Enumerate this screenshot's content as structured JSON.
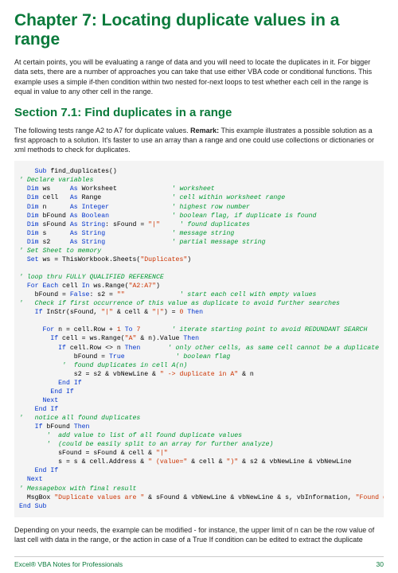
{
  "chapter_title": "Chapter 7: Locating duplicate values in a range",
  "intro_p": "At certain points, you will be evaluating a range of data and you will need to locate the duplicates in it. For bigger data sets, there are a number of approaches you can take that use either VBA code or conditional functions. This example uses a simple if-then condition within two nested for-next loops to test whether each cell in the range is equal in value to any other cell in the range.",
  "section_title": "Section 7.1: Find duplicates in a range",
  "section_p_lead": "The following tests range A2 to A7 for duplicate values. ",
  "section_p_bold": "Remark:",
  "section_p_rest": " This example illustrates a possible solution as a first approach to a solution. It's faster to use an array than a range and one could use collections or dictionaries or xml methods to check for duplicates.",
  "code": {
    "l1a": "Sub",
    "l1b": " find_duplicates()",
    "l2": "' Declare variables",
    "l3a": "Dim",
    "l3b": " ws     ",
    "l3c": "As",
    "l3d": " Worksheet              ",
    "l3e": "' worksheet",
    "l4a": "Dim",
    "l4b": " cell   ",
    "l4c": "As",
    "l4d": " Range                  ",
    "l4e": "' cell within worksheet range",
    "l5a": "Dim",
    "l5b": " n      ",
    "l5c": "As",
    "l5d": " ",
    "l5e": "Integer",
    "l5f": "                ",
    "l5g": "' highest row number",
    "l6a": "Dim",
    "l6b": " bFound ",
    "l6c": "As",
    "l6d": " ",
    "l6e": "Boolean",
    "l6f": "                ",
    "l6g": "' boolean flag, if duplicate is found",
    "l7a": "Dim",
    "l7b": " sFound ",
    "l7c": "As",
    "l7d": " ",
    "l7e": "String",
    "l7f": ": sFound = ",
    "l7g": "\"|\"",
    "l7h": "     ",
    "l7i": "' found duplicates",
    "l8a": "Dim",
    "l8b": " s      ",
    "l8c": "As",
    "l8d": " ",
    "l8e": "String",
    "l8f": "                 ",
    "l8g": "' message string",
    "l9a": "Dim",
    "l9b": " s2     ",
    "l9c": "As",
    "l9d": " ",
    "l9e": "String",
    "l9f": "                 ",
    "l9g": "' partial message string",
    "l10": "' Set Sheet to memory",
    "l11a": "Set",
    "l11b": " ws = ThisWorkbook.Sheets(",
    "l11c": "\"Duplicates\"",
    "l11d": ")",
    "l13": "' loop thru FULLY QUALIFIED REFERENCE",
    "l14a": "For",
    "l14b": " ",
    "l14c": "Each",
    "l14d": " cell ",
    "l14e": "In",
    "l14f": " ws.Range(",
    "l14g": "\"A2:A7\"",
    "l14h": ")",
    "l15a": "    bFound = ",
    "l15b": "False",
    "l15c": ": s2 = ",
    "l15d": "\"\"",
    "l15e": "              ",
    "l15f": "' start each cell with empty values",
    "l16": "'   Check if first occurrence of this value as duplicate to avoid further searches",
    "l17a": "If",
    "l17b": " InStr(sFound, ",
    "l17c": "\"|\"",
    "l17d": " & cell & ",
    "l17e": "\"|\"",
    "l17f": ") = ",
    "l17g": "0",
    "l17h": " ",
    "l17i": "Then",
    "l19a": "For",
    "l19b": " n = cell.Row + ",
    "l19c": "1",
    "l19d": " ",
    "l19e": "To",
    "l19f": " ",
    "l19g": "7",
    "l19h": "        ",
    "l19i": "' iterate starting point to avoid REDUNDANT SEARCH",
    "l20a": "If",
    "l20b": " cell = ws.Range(",
    "l20c": "\"A\"",
    "l20d": " & n).Value ",
    "l20e": "Then",
    "l21a": "If",
    "l21b": " cell.Row <> n ",
    "l21c": "Then",
    "l21d": "       ",
    "l21e": "' only other cells, as same cell cannot be a duplicate",
    "l22a": "              bFound = ",
    "l22b": "True",
    "l22c": "             ",
    "l22d": "' boolean flag",
    "l23": "           '  found duplicates in cell A(n)",
    "l24a": "              s2 = s2 & vbNewLine & ",
    "l24b": "\" -> duplicate in A\"",
    "l24c": " & n",
    "l25a": "End",
    "l25b": " ",
    "l25c": "If",
    "l26a": "End",
    "l26b": " ",
    "l26c": "If",
    "l27": "Next",
    "l28a": "End",
    "l28b": " ",
    "l28c": "If",
    "l29": "'   notice all found duplicates",
    "l30a": "If",
    "l30b": " bFound ",
    "l30c": "Then",
    "l31": "       '  add value to list of all found duplicate values",
    "l32": "       '  (could be easily split to an array for further analyze)",
    "l33a": "          sFound = sFound & cell & ",
    "l33b": "\"|\"",
    "l34a": "          s = s & cell.Address & ",
    "l34b": "\" (value=\"",
    "l34c": " & cell & ",
    "l34d": "\")\"",
    "l34e": " & s2 & vbNewLine & vbNewLine",
    "l35a": "End",
    "l35b": " ",
    "l35c": "If",
    "l36": "Next",
    "l37": "' Messagebox with final result",
    "l38a": "  MsgBox ",
    "l38b": "\"Duplicate values are \"",
    "l38c": " & sFound & vbNewLine & vbNewLine & s, vbInformation, ",
    "l38d": "\"Found duplicates\"",
    "l39a": "End",
    "l39b": " ",
    "l39c": "Sub"
  },
  "outro_p": "Depending on your needs, the example can be modified - for instance, the upper limit of n can be the row value of last cell with data in the range, or the action in case of a True If condition can be edited to extract the duplicate",
  "footer_left": "Excel® VBA Notes for Professionals",
  "footer_right": "30"
}
